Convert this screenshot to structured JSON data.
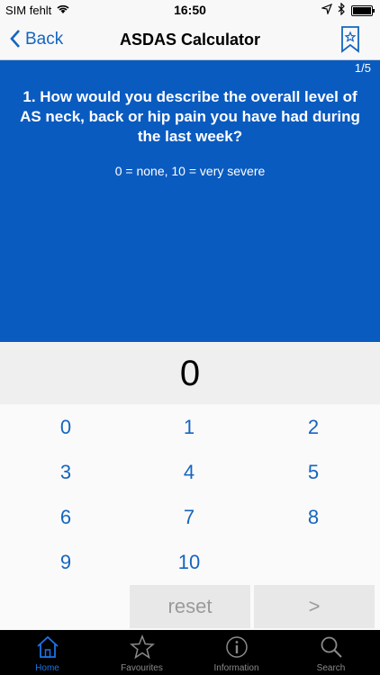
{
  "status_bar": {
    "carrier": "SIM fehlt",
    "time": "16:50"
  },
  "nav": {
    "back_label": "Back",
    "title": "ASDAS Calculator"
  },
  "question": {
    "counter": "1/5",
    "text": "1. How would you describe the overall level of AS neck, back or hip pain you have had during the last week?",
    "scale": "0 = none, 10 = very severe"
  },
  "display": {
    "value": "0"
  },
  "keypad": {
    "keys": [
      "0",
      "1",
      "2",
      "3",
      "4",
      "5",
      "6",
      "7",
      "8",
      "9",
      "10"
    ],
    "reset_label": "reset",
    "next_label": ">"
  },
  "tabbar": {
    "tabs": [
      {
        "label": "Home",
        "icon": "home-icon",
        "active": true
      },
      {
        "label": "Favourites",
        "icon": "star-icon",
        "active": false
      },
      {
        "label": "Information",
        "icon": "info-icon",
        "active": false
      },
      {
        "label": "Search",
        "icon": "search-icon",
        "active": false
      }
    ]
  },
  "colors": {
    "accent": "#1565c0",
    "question_bg": "#0a5bc0",
    "tab_active": "#1a73e8"
  }
}
